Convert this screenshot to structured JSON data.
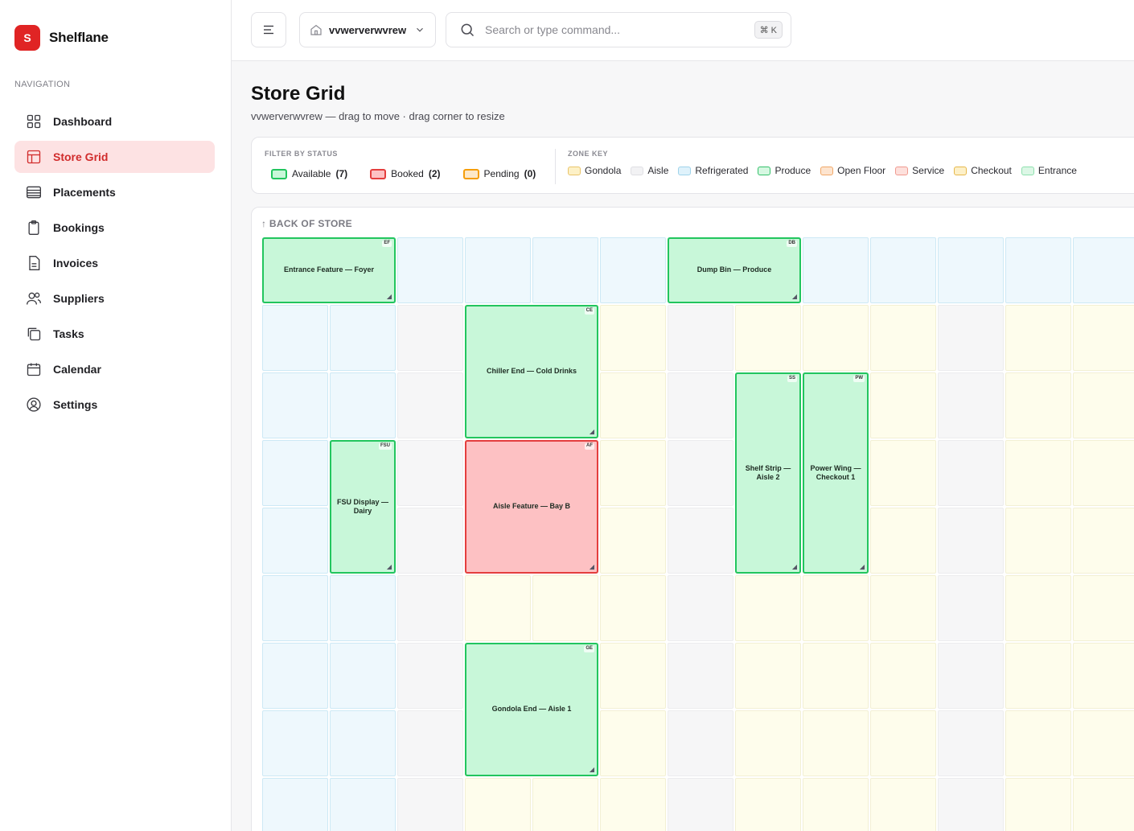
{
  "brand": {
    "logo_letter": "S",
    "name": "Shelflane",
    "logo_color": "#e02424"
  },
  "nav": {
    "label": "NAVIGATION",
    "items": [
      {
        "label": "Dashboard",
        "icon": "grid-icon",
        "active": false
      },
      {
        "label": "Store Grid",
        "icon": "layout-icon",
        "active": true
      },
      {
        "label": "Placements",
        "icon": "list-icon",
        "active": false
      },
      {
        "label": "Bookings",
        "icon": "clipboard-icon",
        "active": false
      },
      {
        "label": "Invoices",
        "icon": "file-icon",
        "active": false
      },
      {
        "label": "Suppliers",
        "icon": "users-icon",
        "active": false
      },
      {
        "label": "Tasks",
        "icon": "copy-icon",
        "active": false
      },
      {
        "label": "Calendar",
        "icon": "calendar-icon",
        "active": false
      },
      {
        "label": "Settings",
        "icon": "user-circle-icon",
        "active": false
      }
    ]
  },
  "topbar": {
    "store_name": "vvwerverwvrew",
    "search_placeholder": "Search or type command...",
    "shortcut": "⌘ K"
  },
  "header": {
    "title": "Store Grid",
    "subtitle": "vvwerverwvrew — drag to move · drag corner to resize"
  },
  "filters": {
    "status_heading": "FILTER BY STATUS",
    "statuses": [
      {
        "label": "Available",
        "count": "(7)",
        "bg": "#c8f7d9",
        "border": "#22c55e"
      },
      {
        "label": "Booked",
        "count": "(2)",
        "bg": "#fdc1c3",
        "border": "#e43e3e"
      },
      {
        "label": "Pending",
        "count": "(0)",
        "bg": "#fde8c8",
        "border": "#f59e0b"
      }
    ],
    "zone_heading": "ZONE KEY",
    "zones": [
      {
        "label": "Gondola",
        "bg": "#fdf1c7",
        "border": "#e9c46a"
      },
      {
        "label": "Aisle",
        "bg": "#f2f2f4",
        "border": "#dfdfe3"
      },
      {
        "label": "Refrigerated",
        "bg": "#dff2fb",
        "border": "#9fd3ea"
      },
      {
        "label": "Produce",
        "bg": "#d6f8e2",
        "border": "#34c06a"
      },
      {
        "label": "Open Floor",
        "bg": "#fde4cf",
        "border": "#f0a868"
      },
      {
        "label": "Service",
        "bg": "#fde0dc",
        "border": "#f09a90"
      },
      {
        "label": "Checkout",
        "bg": "#fdf0c8",
        "border": "#e6b84c"
      },
      {
        "label": "Entrance",
        "bg": "#dcf7e6",
        "border": "#8ee0ae"
      }
    ]
  },
  "grid": {
    "back_label": "↑ BACK OF STORE",
    "zone_rows": [
      [
        "refr",
        "refr",
        "refr",
        "refr",
        "refr",
        "refr",
        "refr",
        "refr",
        "refr",
        "refr",
        "refr",
        "refr",
        "refr"
      ],
      [
        "refr",
        "refr",
        "aisle",
        "gond",
        "gond",
        "gond",
        "aisle",
        "gond",
        "gond",
        "gond",
        "aisle",
        "gond",
        "gond"
      ],
      [
        "refr",
        "refr",
        "aisle",
        "gond",
        "gond",
        "gond",
        "aisle",
        "gond",
        "gond",
        "gond",
        "aisle",
        "gond",
        "gond"
      ],
      [
        "refr",
        "refr",
        "aisle",
        "gond",
        "gond",
        "gond",
        "aisle",
        "gond",
        "gond",
        "gond",
        "aisle",
        "gond",
        "gond"
      ],
      [
        "refr",
        "refr",
        "aisle",
        "gond",
        "gond",
        "gond",
        "aisle",
        "gond",
        "gond",
        "gond",
        "aisle",
        "gond",
        "gond"
      ],
      [
        "refr",
        "refr",
        "aisle",
        "gond",
        "gond",
        "gond",
        "aisle",
        "gond",
        "gond",
        "gond",
        "aisle",
        "gond",
        "gond"
      ],
      [
        "refr",
        "refr",
        "aisle",
        "gond",
        "gond",
        "gond",
        "aisle",
        "gond",
        "gond",
        "gond",
        "aisle",
        "gond",
        "gond"
      ],
      [
        "refr",
        "refr",
        "aisle",
        "gond",
        "gond",
        "gond",
        "aisle",
        "gond",
        "gond",
        "gond",
        "aisle",
        "gond",
        "gond"
      ],
      [
        "refr",
        "refr",
        "aisle",
        "gond",
        "gond",
        "gond",
        "aisle",
        "gond",
        "gond",
        "gond",
        "aisle",
        "gond",
        "gond"
      ]
    ],
    "placements": [
      {
        "name": "Entrance Feature — Foyer",
        "code": "EF",
        "status": "available",
        "col": 0,
        "row": 0,
        "w": 2,
        "h": 1
      },
      {
        "name": "Dump Bin — Produce",
        "code": "DB",
        "status": "available",
        "col": 6,
        "row": 0,
        "w": 2,
        "h": 1
      },
      {
        "name": "Chiller End — Cold Drinks",
        "code": "CE",
        "status": "available",
        "col": 3,
        "row": 1,
        "w": 2,
        "h": 2
      },
      {
        "name": "Shelf Strip — Aisle 2",
        "code": "SS",
        "status": "available",
        "col": 7,
        "row": 2,
        "w": 1,
        "h": 3
      },
      {
        "name": "Power Wing — Checkout 1",
        "code": "PW",
        "status": "available",
        "col": 8,
        "row": 2,
        "w": 1,
        "h": 3
      },
      {
        "name": "FSU Display — Dairy",
        "code": "FSU",
        "status": "available",
        "col": 1,
        "row": 3,
        "w": 1,
        "h": 2
      },
      {
        "name": "Aisle Feature — Bay B",
        "code": "AF",
        "status": "booked",
        "col": 3,
        "row": 3,
        "w": 2,
        "h": 2
      },
      {
        "name": "Gondola End — Aisle 1",
        "code": "GE",
        "status": "available",
        "col": 3,
        "row": 6,
        "w": 2,
        "h": 2
      }
    ]
  }
}
